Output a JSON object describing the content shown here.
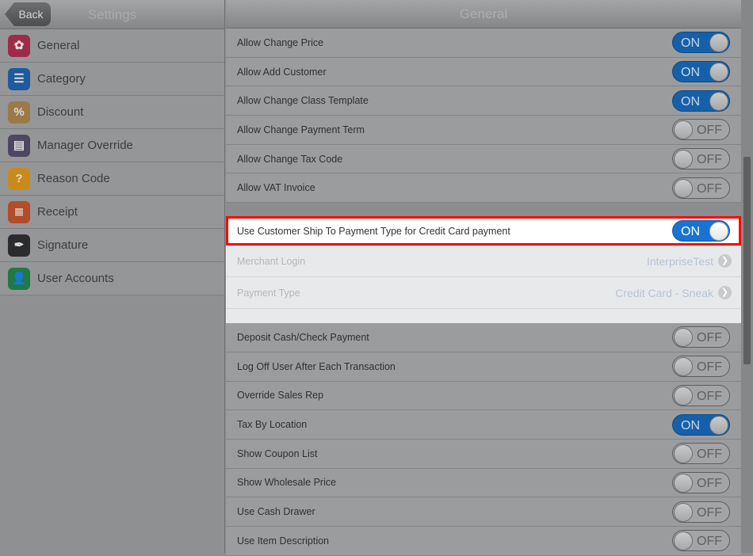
{
  "left": {
    "back": "Back",
    "title": "Settings",
    "items": [
      {
        "label": "General",
        "icon": "gear-icon",
        "color": "#9e2b4b",
        "glyph": "✿"
      },
      {
        "label": "Category",
        "icon": "list-icon",
        "color": "#1d5a9e",
        "glyph": "☰"
      },
      {
        "label": "Discount",
        "icon": "tag-icon",
        "color": "#9c7a48",
        "glyph": "%"
      },
      {
        "label": "Manager Override",
        "icon": "id-card-icon",
        "color": "#4e4760",
        "glyph": "▤"
      },
      {
        "label": "Reason Code",
        "icon": "question-icon",
        "color": "#c88a1a",
        "glyph": "?"
      },
      {
        "label": "Receipt",
        "icon": "receipt-icon",
        "color": "#b24c2a",
        "glyph": "≣"
      },
      {
        "label": "Signature",
        "icon": "pen-icon",
        "color": "#2b2c2e",
        "glyph": "✒"
      },
      {
        "label": "User Accounts",
        "icon": "user-key-icon",
        "color": "#1f7a43",
        "glyph": "👤"
      }
    ]
  },
  "right": {
    "title": "General",
    "top": [
      {
        "label": "Allow Change Price",
        "state": "ON"
      },
      {
        "label": "Allow Add Customer",
        "state": "ON"
      },
      {
        "label": "Allow Change Class Template",
        "state": "ON"
      },
      {
        "label": "Allow Change Payment Term",
        "state": "OFF"
      },
      {
        "label": "Allow Change Tax Code",
        "state": "OFF"
      },
      {
        "label": "Allow VAT Invoice",
        "state": "OFF"
      }
    ],
    "highlight": {
      "label": "Use Customer Ship To Payment Type for Credit Card payment",
      "state": "ON"
    },
    "details": [
      {
        "label": "Merchant Login",
        "value": "InterpriseTest"
      },
      {
        "label": "Payment Type",
        "value": "Credit Card - Sneak"
      }
    ],
    "bottom": [
      {
        "label": "Deposit Cash/Check Payment",
        "state": "OFF"
      },
      {
        "label": "Log Off User After Each Transaction",
        "state": "OFF"
      },
      {
        "label": "Override Sales Rep",
        "state": "OFF"
      },
      {
        "label": "Tax By Location",
        "state": "ON"
      },
      {
        "label": "Show Coupon List",
        "state": "OFF"
      },
      {
        "label": "Show Wholesale Price",
        "state": "OFF"
      },
      {
        "label": "Use Cash Drawer",
        "state": "OFF"
      },
      {
        "label": "Use Item Description",
        "state": "OFF"
      }
    ]
  }
}
